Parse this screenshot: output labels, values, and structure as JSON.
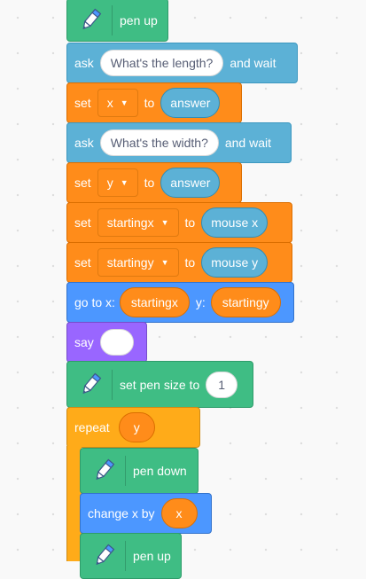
{
  "blocks": {
    "pen_up_top": {
      "label": "pen up"
    },
    "ask_length": {
      "verb": "ask",
      "question": "What's the length?",
      "suffix": "and wait"
    },
    "set_x": {
      "verb": "set",
      "variable": "x",
      "to": "to",
      "value": "answer"
    },
    "ask_width": {
      "verb": "ask",
      "question": "What's the width?",
      "suffix": "and wait"
    },
    "set_y": {
      "verb": "set",
      "variable": "y",
      "to": "to",
      "value": "answer"
    },
    "set_startingx": {
      "verb": "set",
      "variable": "startingx",
      "to": "to",
      "value": "mouse x"
    },
    "set_startingy": {
      "verb": "set",
      "variable": "startingy",
      "to": "to",
      "value": "mouse y"
    },
    "goto": {
      "label": "go to x:",
      "x_value": "startingx",
      "y_label": "y:",
      "y_value": "startingy"
    },
    "say": {
      "label": "say",
      "value": ""
    },
    "pen_size": {
      "label": "set pen size to",
      "value": "1"
    },
    "repeat": {
      "label": "repeat",
      "value": "y"
    },
    "pen_down": {
      "label": "pen down"
    },
    "change_x": {
      "label": "change x by",
      "value": "x"
    },
    "pen_up_bottom": {
      "label": "pen up"
    }
  },
  "colors": {
    "pen": "#3fbd84",
    "sensing": "#5cb1d6",
    "variables": "#ff8c1a",
    "motion": "#4c97ff",
    "looks": "#9966ff",
    "control": "#ffab19"
  },
  "icons": {
    "pen": "pen-icon",
    "dropdown": "caret-down-icon"
  }
}
